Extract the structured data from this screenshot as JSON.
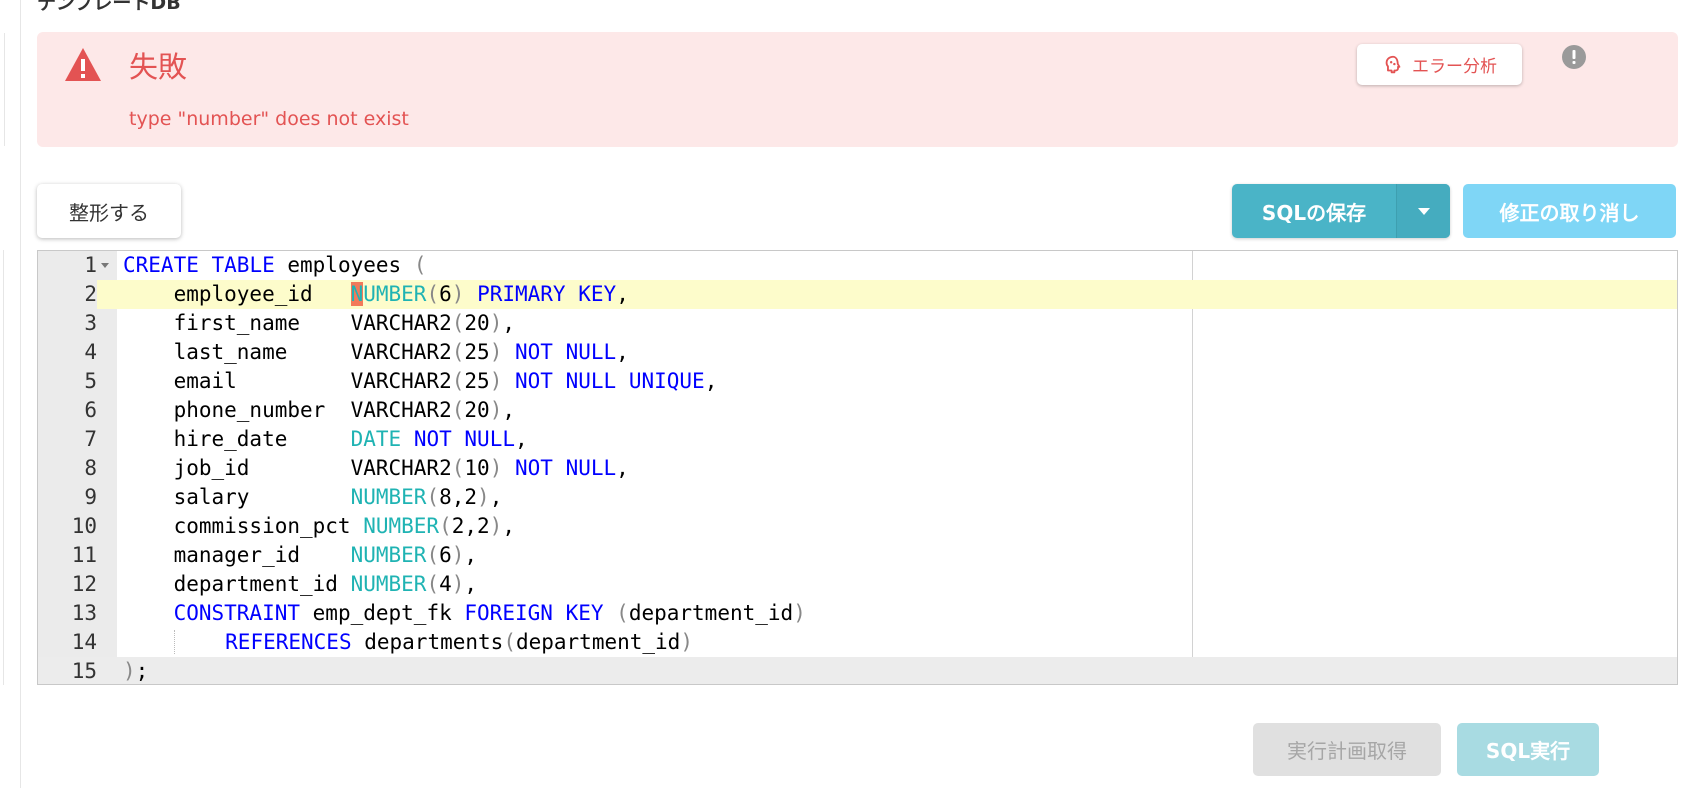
{
  "page": {
    "db_title": "テンプレートDB"
  },
  "alert": {
    "title": "失敗",
    "message": "type \"number\" does not exist",
    "analyze_label": "エラー分析",
    "colors": {
      "background": "#fde8e8",
      "text": "#e35353"
    }
  },
  "toolbar": {
    "format_label": "整形する",
    "save_label": "SQLの保存",
    "revert_label": "修正の取り消し"
  },
  "editor": {
    "active_line": 2,
    "cursor_line": 15,
    "lines": [
      {
        "num": "1",
        "fold": true,
        "tokens": [
          [
            "kw",
            "CREATE"
          ],
          [
            "",
            " "
          ],
          [
            "kw",
            "TABLE"
          ],
          [
            "",
            " employees "
          ],
          [
            "pn",
            "("
          ]
        ]
      },
      {
        "num": "2",
        "tokens": [
          [
            "",
            "    employee_id   "
          ],
          [
            "err",
            "N"
          ],
          [
            "ty",
            "UMBER"
          ],
          [
            "pn",
            "("
          ],
          [
            "",
            "6"
          ],
          [
            "pn",
            ")"
          ],
          [
            "",
            " "
          ],
          [
            "kw",
            "PRIMARY"
          ],
          [
            "",
            " "
          ],
          [
            "kw",
            "KEY"
          ],
          [
            "",
            ","
          ]
        ]
      },
      {
        "num": "3",
        "tokens": [
          [
            "",
            "    first_name    VARCHAR2"
          ],
          [
            "pn",
            "("
          ],
          [
            "",
            "20"
          ],
          [
            "pn",
            ")"
          ],
          [
            "",
            ","
          ]
        ]
      },
      {
        "num": "4",
        "tokens": [
          [
            "",
            "    last_name     VARCHAR2"
          ],
          [
            "pn",
            "("
          ],
          [
            "",
            "25"
          ],
          [
            "pn",
            ")"
          ],
          [
            "",
            " "
          ],
          [
            "kw",
            "NOT"
          ],
          [
            "",
            " "
          ],
          [
            "kw",
            "NULL"
          ],
          [
            "",
            ","
          ]
        ]
      },
      {
        "num": "5",
        "tokens": [
          [
            "",
            "    email         VARCHAR2"
          ],
          [
            "pn",
            "("
          ],
          [
            "",
            "25"
          ],
          [
            "pn",
            ")"
          ],
          [
            "",
            " "
          ],
          [
            "kw",
            "NOT"
          ],
          [
            "",
            " "
          ],
          [
            "kw",
            "NULL"
          ],
          [
            "",
            " "
          ],
          [
            "kw",
            "UNIQUE"
          ],
          [
            "",
            ","
          ]
        ]
      },
      {
        "num": "6",
        "tokens": [
          [
            "",
            "    phone_number  VARCHAR2"
          ],
          [
            "pn",
            "("
          ],
          [
            "",
            "20"
          ],
          [
            "pn",
            ")"
          ],
          [
            "",
            ","
          ]
        ]
      },
      {
        "num": "7",
        "tokens": [
          [
            "",
            "    hire_date     "
          ],
          [
            "ty",
            "DATE"
          ],
          [
            "",
            " "
          ],
          [
            "kw",
            "NOT"
          ],
          [
            "",
            " "
          ],
          [
            "kw",
            "NULL"
          ],
          [
            "",
            ","
          ]
        ]
      },
      {
        "num": "8",
        "tokens": [
          [
            "",
            "    job_id        VARCHAR2"
          ],
          [
            "pn",
            "("
          ],
          [
            "",
            "10"
          ],
          [
            "pn",
            ")"
          ],
          [
            "",
            " "
          ],
          [
            "kw",
            "NOT"
          ],
          [
            "",
            " "
          ],
          [
            "kw",
            "NULL"
          ],
          [
            "",
            ","
          ]
        ]
      },
      {
        "num": "9",
        "tokens": [
          [
            "",
            "    salary        "
          ],
          [
            "ty",
            "NUMBER"
          ],
          [
            "pn",
            "("
          ],
          [
            "",
            "8,2"
          ],
          [
            "pn",
            ")"
          ],
          [
            "",
            ","
          ]
        ]
      },
      {
        "num": "10",
        "tokens": [
          [
            "",
            "    commission_pct "
          ],
          [
            "ty",
            "NUMBER"
          ],
          [
            "pn",
            "("
          ],
          [
            "",
            "2,2"
          ],
          [
            "pn",
            ")"
          ],
          [
            "",
            ","
          ]
        ]
      },
      {
        "num": "11",
        "tokens": [
          [
            "",
            "    manager_id    "
          ],
          [
            "ty",
            "NUMBER"
          ],
          [
            "pn",
            "("
          ],
          [
            "",
            "6"
          ],
          [
            "pn",
            ")"
          ],
          [
            "",
            ","
          ]
        ]
      },
      {
        "num": "12",
        "tokens": [
          [
            "",
            "    department_id "
          ],
          [
            "ty",
            "NUMBER"
          ],
          [
            "pn",
            "("
          ],
          [
            "",
            "4"
          ],
          [
            "pn",
            ")"
          ],
          [
            "",
            ","
          ]
        ]
      },
      {
        "num": "13",
        "tokens": [
          [
            "",
            "    "
          ],
          [
            "kw",
            "CONSTRAINT"
          ],
          [
            "",
            " emp_dept_fk "
          ],
          [
            "kw",
            "FOREIGN"
          ],
          [
            "",
            " "
          ],
          [
            "kw",
            "KEY"
          ],
          [
            "",
            " "
          ],
          [
            "pn",
            "("
          ],
          [
            "",
            "department_id"
          ],
          [
            "pn",
            ")"
          ]
        ]
      },
      {
        "num": "14",
        "tokens": [
          [
            "",
            "    "
          ],
          [
            "guide",
            ""
          ],
          [
            "",
            "    "
          ],
          [
            "kw",
            "REFERENCES"
          ],
          [
            "",
            " departments"
          ],
          [
            "pn",
            "("
          ],
          [
            "",
            "department_id"
          ],
          [
            "pn",
            ")"
          ]
        ]
      },
      {
        "num": "15",
        "tokens": [
          [
            "pn",
            ")"
          ],
          [
            "",
            ";"
          ]
        ]
      }
    ]
  },
  "footer": {
    "plan_label": "実行計画取得",
    "run_label": "SQL実行"
  },
  "icons": {
    "alert": "warning-triangle-icon",
    "analyze": "brain-icon",
    "info": "exclamation-circle-icon",
    "dropdown": "caret-down-icon"
  }
}
